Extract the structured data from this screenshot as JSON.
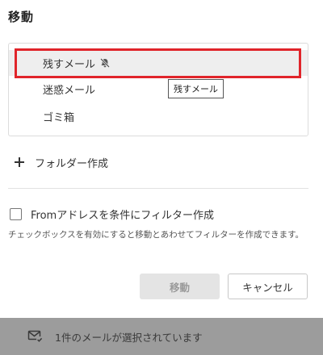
{
  "dialog": {
    "title": "移動",
    "folders": [
      {
        "label": "残すメール",
        "selected": true,
        "muted": true
      },
      {
        "label": "迷惑メール",
        "selected": false,
        "muted": false
      },
      {
        "label": "ゴミ箱",
        "selected": false,
        "muted": false
      }
    ],
    "tooltip": "残すメール",
    "add_folder_label": "フォルダー作成",
    "filter_checkbox_label": "Fromアドレスを条件にフィルター作成",
    "filter_checked": false,
    "help_text": "チェックボックスを有効にすると移動とあわせてフィルターを作成できます。",
    "move_button": "移動",
    "cancel_button": "キャンセル"
  },
  "footer": {
    "status_text": "1件のメールが選択されています"
  },
  "colors": {
    "highlight": "#e0242a",
    "selected_row": "#eeeeee",
    "footer_bg": "#9c9c9c",
    "disabled_button": "#e4e4e4"
  },
  "icons": [
    "bell-slash-icon",
    "plus-icon",
    "mail-check-icon"
  ]
}
